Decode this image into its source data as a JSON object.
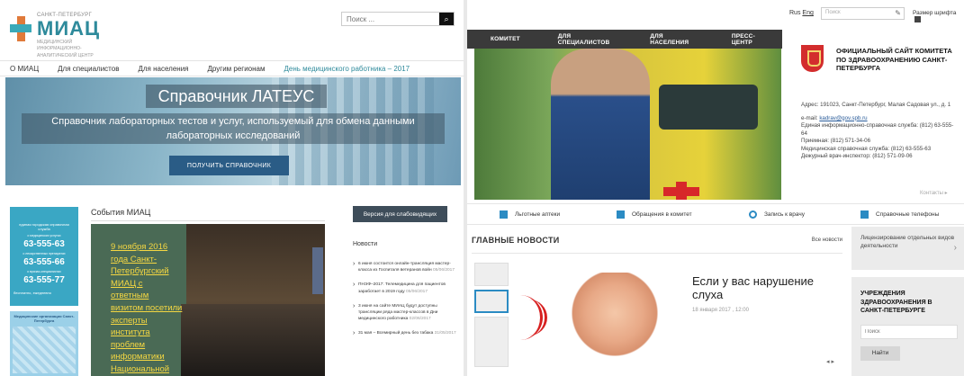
{
  "left": {
    "logo": {
      "city": "САНКТ-ПЕТЕРБУРГ",
      "name": "МИАЦ",
      "sub1": "МЕДИЦИНСКИЙ",
      "sub2": "ИНФОРМАЦИОННО-",
      "sub3": "АНАЛИТИЧЕСКИЙ ЦЕНТР"
    },
    "search_placeholder": "Поиск ...",
    "nav": [
      "О МИАЦ",
      "Для специалистов",
      "Для населения",
      "Другим регионам",
      "День медицинского работника – 2017"
    ],
    "hero": {
      "title": "Справочник ЛАТЕУС",
      "desc": "Справочник лабораторных тестов и услуг, используемый для обмена данными лабораторных исследований",
      "button": "ПОЛУЧИТЬ СПРАВОЧНИК"
    },
    "banner1": {
      "text1": "единая городская справочная служба",
      "text2": "о медицинских услугах",
      "phone1": "63-555-63",
      "text3": "о лекарственных препаратах",
      "phone2": "63-555-66",
      "text4": "о врачах-специалистах",
      "phone3": "63-555-77",
      "footer": "бесплатно, ежедневно"
    },
    "banner2": {
      "title": "Медицинские организации Санкт-Петербурга"
    },
    "events": {
      "title": "События МИАЦ",
      "text": "9 ноября 2016 года Санкт-Петербургский МИАЦ с ответным визитом посетили эксперты института проблем информатики Национальной"
    },
    "visual_button": "Версия для слабовидящих",
    "news_title": "Новости",
    "news": [
      {
        "text": "6 июня состоится онлайн-трансляция мастер-класса из Госпиталя ветеранов войн",
        "date": "05/06/2017"
      },
      {
        "text": "ПНЭФ–2017: Телемедицина для пациентов заработает в 2019 году",
        "date": "05/06/2017"
      },
      {
        "text": "3 июня на сайте МИАЦ будут доступны трансляции ряда мастер-классов в Дни медицинского работника",
        "date": "02/06/2017"
      },
      {
        "text": "31 мая – Всемирный день без табака",
        "date": "31/05/2017"
      }
    ]
  },
  "right": {
    "lang_ru": "Rus",
    "lang_en": "Eng",
    "search_placeholder": "Поиск",
    "font_size_label": "Размер шрифта",
    "nav": [
      "КОМИТЕТ",
      "ДЛЯ СПЕЦИАЛИСТОВ",
      "ДЛЯ НАСЕЛЕНИЯ",
      "ПРЕСС-ЦЕНТР"
    ],
    "org_title": "ОФИЦИАЛЬНЫЙ САЙТ КОМИТЕТА ПО ЗДРАВООХРАНЕНИЮ САНКТ-ПЕТЕРБУРГА",
    "address": "Адрес: 191023, Санкт-Петербург, Малая Садовая ул., д. 1",
    "email_label": "e-mail:",
    "email": "kadrav@gov.spb.ru",
    "info1": "Единая информационно-справочная служба: (812) 63-555-64",
    "info2": "Приемная: (812) 571-34-06",
    "info3": "Медицинская справочная служба: (812) 63-555-63",
    "info4": "Дежурный врач-инспектор: (812) 571-09-06",
    "more": "Контакты ▸",
    "quick": [
      "Льготные аптеки",
      "Обращения в комитет",
      "Запись к врачу",
      "Справочные телефоны"
    ],
    "news_title": "ГЛАВНЫЕ НОВОСТИ",
    "news_all": "Все новости",
    "featured": {
      "title": "Если у вас нарушение слуха",
      "date": "18 января 2017 , 12:00"
    },
    "side_box": "Лицензирование отдельных видов деятельности",
    "inst_title": "УЧРЕЖДЕНИЯ ЗДРАВООХРАНЕНИЯ В САНКТ-ПЕТЕРБУРГЕ",
    "inst_placeholder": "Поиск",
    "find_button": "Найти"
  }
}
